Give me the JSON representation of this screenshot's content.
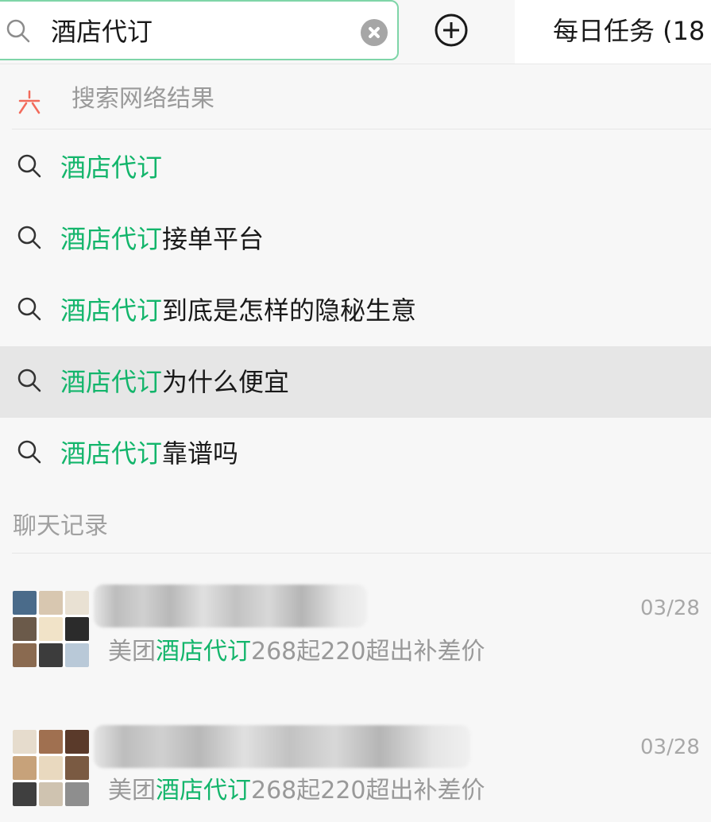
{
  "search": {
    "query": "酒店代订"
  },
  "tab": {
    "label": "每日任务 (18"
  },
  "web_search": {
    "label": "搜索网络结果"
  },
  "suggestions": [
    {
      "highlight": "酒店代订",
      "rest": ""
    },
    {
      "highlight": "酒店代订",
      "rest": "接单平台"
    },
    {
      "highlight": "酒店代订",
      "rest": "到底是怎样的隐秘生意"
    },
    {
      "highlight": "酒店代订",
      "rest": "为什么便宜"
    },
    {
      "highlight": "酒店代订",
      "rest": "靠谱吗"
    }
  ],
  "chat_section": {
    "label": "聊天记录"
  },
  "chats": [
    {
      "date": "03/28",
      "preview_prefix": "美团",
      "preview_highlight": "酒店代订",
      "preview_rest": "268起220超出补差价"
    },
    {
      "date": "03/28",
      "preview_prefix": "美团",
      "preview_highlight": "酒店代订",
      "preview_rest": "268起220超出补差价"
    }
  ],
  "colors": {
    "accent": "#13b56b",
    "focus_border": "#7fd5a8",
    "selected_row": "#e6e6e6"
  },
  "icons": [
    "search-icon",
    "clear-icon",
    "add-icon",
    "web-search-icon"
  ]
}
